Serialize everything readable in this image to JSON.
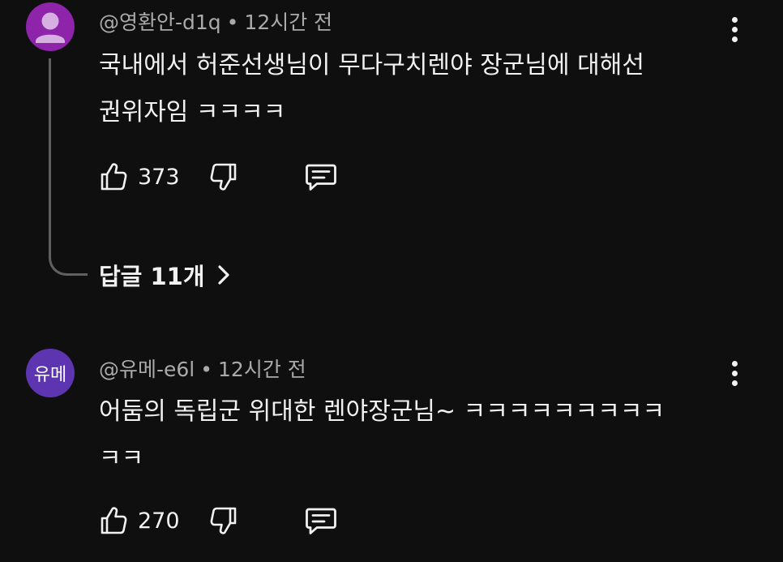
{
  "comments": [
    {
      "author": "@영환안-d1q",
      "time": "12시간 전",
      "text": "국내에서 허준선생님이 무다구치렌야 장군님에 대해선\n권위자임 ㅋㅋㅋㅋ",
      "likes": "373",
      "replies_label": "답글 11개",
      "avatar_color": "#8e24aa"
    },
    {
      "author": "@유메-e6l",
      "time": "12시간 전",
      "avatar_text": "유메",
      "text": "어둠의 독립군 위대한 렌야장군님~ ㅋㅋㅋㅋㅋㅋㅋㅋㅋ\nㅋㅋ",
      "likes": "270",
      "avatar_color": "#5e35b1"
    }
  ],
  "separator": "•",
  "icons": [
    "person-icon",
    "more-vert-icon",
    "thumb-up-icon",
    "thumb-down-icon",
    "reply-comment-icon",
    "chevron-right-icon"
  ]
}
